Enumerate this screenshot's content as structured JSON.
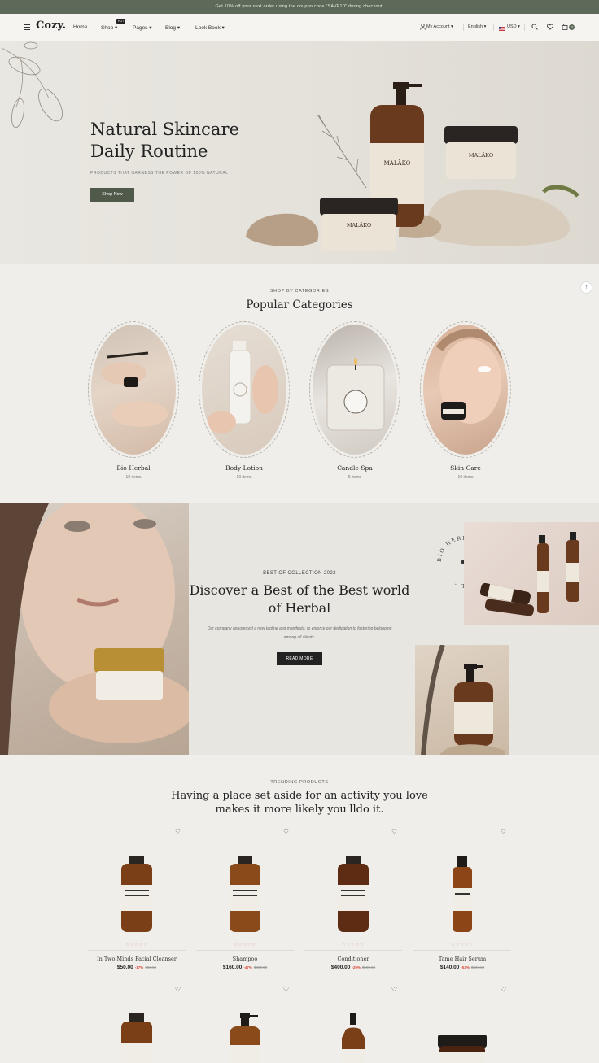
{
  "announcement": "Get 10% off your next order using the coupon code \"SAVE10\" during checkout.",
  "header": {
    "logo": "Cozy.",
    "nav": [
      {
        "label": "Home"
      },
      {
        "label": "Shop ▾",
        "badge": "HOT"
      },
      {
        "label": "Pages ▾"
      },
      {
        "label": "Blog ▾"
      },
      {
        "label": "Look Book ▾"
      }
    ],
    "account": "My Account ▾",
    "language": "English ▾",
    "currency": "USD ▾",
    "cart_count": "0"
  },
  "hero": {
    "title": "Natural Skincare\nDaily Routine",
    "subtitle": "PRODUCTS THAT HARNESS THE POWER OF 100% NATURAL",
    "button": "Shop Now",
    "brand_label": "MALĀKO"
  },
  "categories": {
    "eyebrow": "SHOP BY CATEGORIES",
    "title": "Popular Categories",
    "items": [
      {
        "name": "Bio-Herbal",
        "count": "10 items"
      },
      {
        "name": "Body-Lotion",
        "count": "10 items"
      },
      {
        "name": "Candle-Spa",
        "count": "5 items"
      },
      {
        "name": "Skin-Care",
        "count": "10 items"
      }
    ]
  },
  "collection": {
    "eyebrow": "BEST OF COLLECTION 2022",
    "title": "Discover a Best of the Best world of Herbal",
    "text": "Our company announced a new tagline and manifesto, to enforce our dedication to fostering belonging among all clients.",
    "button": "READ MORE",
    "badge_text": "BIO HERBAL - BIO HERBAL -"
  },
  "trending": {
    "eyebrow": "TRENDING PRODUCTS",
    "title": "Having a place set aside for an activity you love makes it more likely you'lldo it.",
    "products": [
      {
        "title": "In Two Minds Facial Cleanser",
        "price": "$50.00",
        "discount": "-17%",
        "old_price": "$60.00"
      },
      {
        "title": "Shampoo",
        "price": "$160.00",
        "discount": "-47%",
        "old_price": "$300.00"
      },
      {
        "title": "Conditioner",
        "price": "$400.00",
        "discount": "-20%",
        "old_price": "$500.00"
      },
      {
        "title": "Tame Hair Serum",
        "price": "$140.00",
        "discount": "-53%",
        "old_price": "$300.00"
      }
    ]
  },
  "colors": {
    "accent": "#5e6a59",
    "sale": "#d9483b",
    "background": "#efeeea"
  }
}
